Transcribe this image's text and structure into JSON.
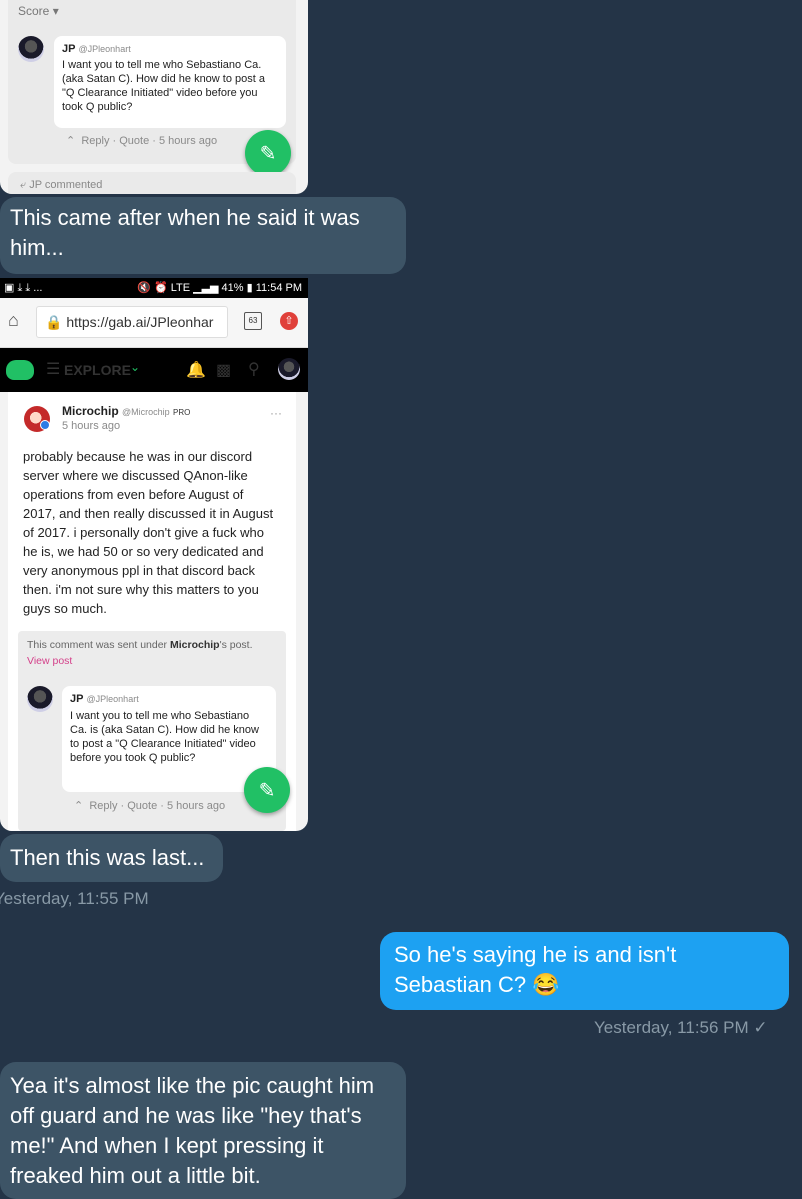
{
  "card1": {
    "sort_label": "Score",
    "jp_name": "JP",
    "jp_handle": "@JPleonhart",
    "jp_text": "I want you to tell me who Sebastiano Ca.          (aka Satan C). How did he know to post a \"Q Clearance Initiated\" video before you took Q public?",
    "reply": "Reply",
    "quote": "Quote",
    "time": "5 hours ago",
    "commented": "JP commented"
  },
  "msg1": "This came after when he said it was him...",
  "card2": {
    "status_left": "▣ ⤓ ⤓ ...",
    "status_right": "🔇 ⏰ LTE ▁▃▅ 41% ▮ 11:54 PM",
    "url": "https://gab.ai/JPleonhar",
    "tab_count": "63",
    "nav_explore": "EXPLORE",
    "post_name": "Microchip",
    "post_handle": "@Microchip",
    "post_badge": "PRO",
    "post_time": "5 hours ago",
    "post_body": "probably because he was in our discord server where we discussed QAnon-like operations from even before August of 2017, and then really discussed it in August of 2017. i personally don't give a fuck who he is, we had 50 or so very dedicated and very anonymous ppl in that discord back then. i'm not sure why this matters to you guys so much.",
    "sent_under_prefix": "This comment was sent under ",
    "sent_under_name": "Microchip",
    "sent_under_suffix": "'s post.",
    "view_post": "View post",
    "jp_name": "JP",
    "jp_handle": "@JPleonhart",
    "jp_text": "I want you to tell me who Sebastiano Ca.          is (aka Satan C). How did he know to post a \"Q Clearance Initiated\" video before you took Q public?",
    "reply": "Reply",
    "quote": "Quote",
    "time": "5 hours ago"
  },
  "msg2": "Then this was last...",
  "ts1": "Yesterday, 11:55 PM",
  "msg3": "So he's saying he is and isn't Sebastian C? 😂",
  "ts2": "Yesterday, 11:56 PM ✓",
  "msg4": "Yea it's almost like the pic caught him off guard and he was like \"hey that's me!\" And when I kept pressing it freaked him out a little bit.",
  "colors": {
    "background": "#243447",
    "incoming_bubble": "#3d5466",
    "outgoing_bubble": "#1da1f2",
    "gab_green": "#21c065"
  }
}
